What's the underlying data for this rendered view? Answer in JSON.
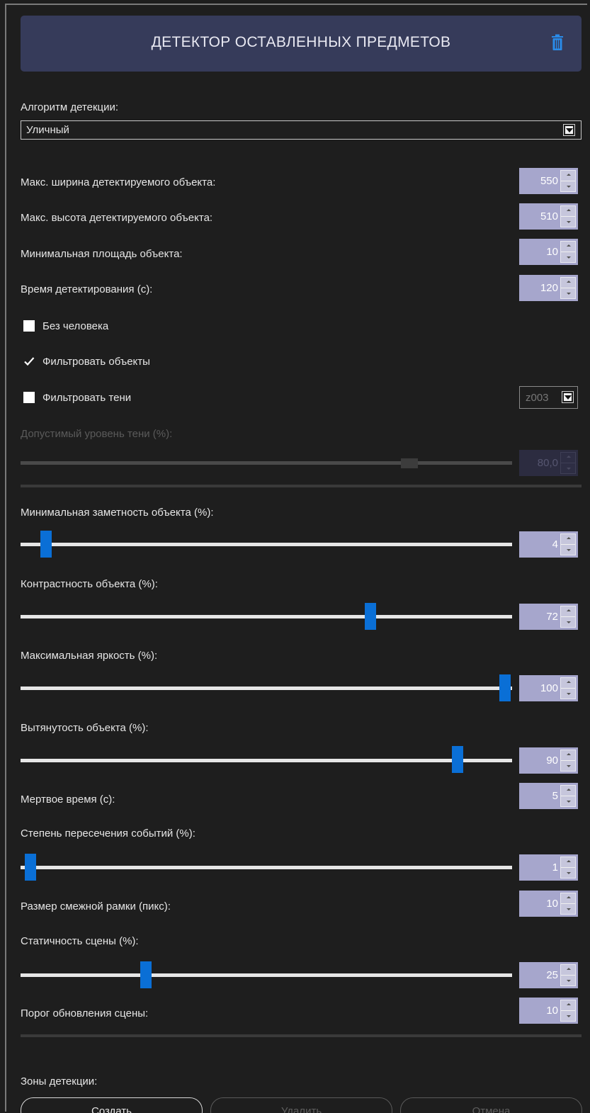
{
  "header": {
    "title": "ДЕТЕКТОР ОСТАВЛЕННЫХ ПРЕДМЕТОВ"
  },
  "algorithm": {
    "label": "Алгоритм детекции:",
    "value": "Уличный"
  },
  "fields": {
    "max_width": {
      "label": "Макс. ширина детектируемого объекта:",
      "value": "550"
    },
    "max_height": {
      "label": "Макс. высота детектируемого объекта:",
      "value": "510"
    },
    "min_area": {
      "label": "Минимальная площадь объекта:",
      "value": "10"
    },
    "detect_time": {
      "label": "Время детектирования (с):",
      "value": "120"
    }
  },
  "checkboxes": {
    "no_person": {
      "label": "Без человека",
      "checked": false
    },
    "filter_objects": {
      "label": "Фильтровать объекты",
      "checked": true
    },
    "filter_shadows": {
      "label": "Фильтровать тени",
      "checked": false,
      "option": "z003"
    }
  },
  "shadow_level": {
    "label": "Допустимый уровень тени (%):",
    "value": "80,0",
    "level": 80,
    "enabled": false
  },
  "sliders": {
    "min_visibility": {
      "label": "Минимальная заметность объекта (%):",
      "value": "4",
      "level": 4
    },
    "contrast": {
      "label": "Контрастность объекта (%):",
      "value": "72",
      "level": 72
    },
    "max_brightness": {
      "label": "Максимальная яркость (%):",
      "value": "100",
      "level": 100
    },
    "elongation": {
      "label": "Вытянутость объекта (%):",
      "value": "90",
      "level": 90
    }
  },
  "dead_time": {
    "label": "Мертвое время (с):",
    "value": "5"
  },
  "overlap": {
    "label": "Степень пересечения событий (%):",
    "value": "1",
    "level": 1
  },
  "border_size": {
    "label": "Размер смежной рамки (пикс):",
    "value": "10"
  },
  "scene_static": {
    "label": "Статичность сцены (%):",
    "value": "25",
    "level": 25
  },
  "scene_update": {
    "label": "Порог обновления сцены:",
    "value": "10"
  },
  "zones": {
    "label": "Зоны детекции:",
    "create": "Создать",
    "delete": "Удалить",
    "cancel": "Отмена"
  },
  "colors": {
    "accent": "#0a6fd6",
    "header_bg": "#363b5a",
    "spin_bg": "#a6a6cc"
  },
  "icons": {
    "delete": "trash-icon",
    "dropdown": "chevron-down-icon"
  }
}
